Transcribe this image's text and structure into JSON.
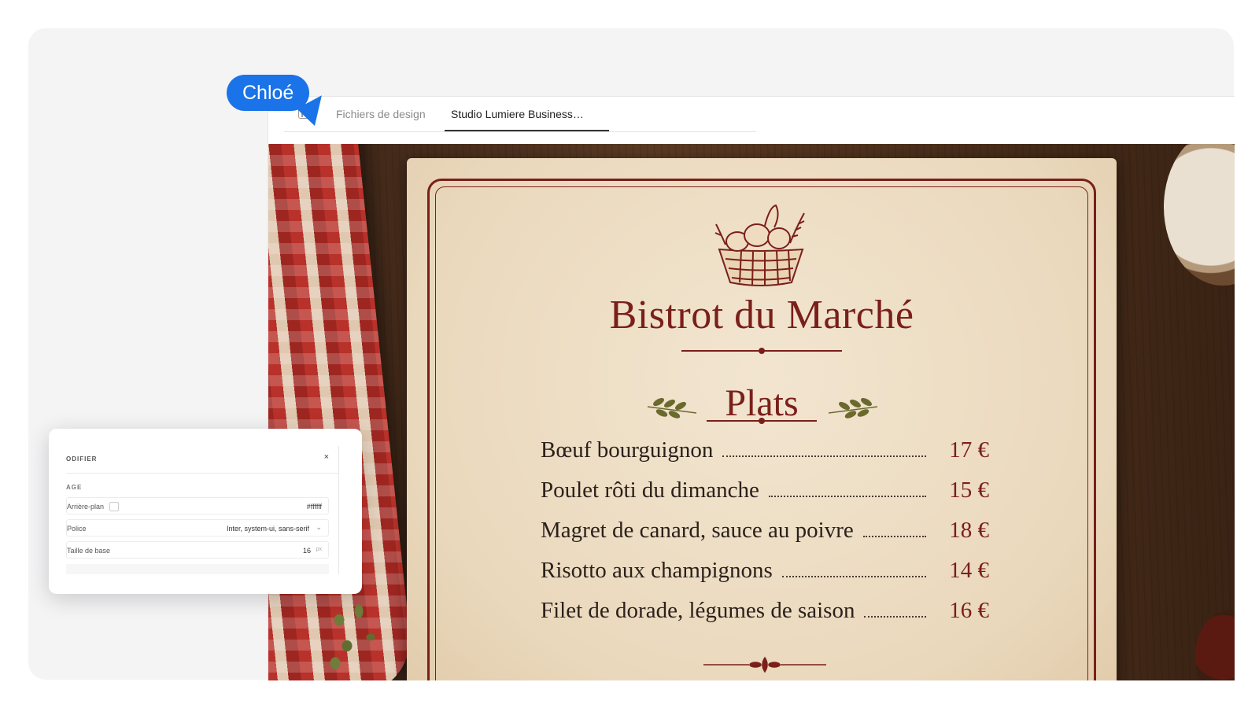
{
  "collaborator": {
    "name": "Chloé",
    "color": "#1a73e8"
  },
  "tabs": [
    {
      "label": "Fichiers de design"
    },
    {
      "label": "Studio Lumiere Business…"
    }
  ],
  "menu": {
    "restaurant_name": "Bistrot du Marché",
    "section_title": "Plats",
    "accent_color": "#7a1f1a",
    "dishes": [
      {
        "name": "Bœuf bourguignon",
        "price": "17 €"
      },
      {
        "name": "Poulet rôti du dimanche",
        "price": "15 €"
      },
      {
        "name": "Magret de canard, sauce au poivre",
        "price": "18 €"
      },
      {
        "name": "Risotto aux champignons",
        "price": "14 €"
      },
      {
        "name": "Filet de dorade, légumes de saison",
        "price": "16 €"
      }
    ]
  },
  "panel": {
    "title": "ODIFIER",
    "close": "×",
    "section": "AGE",
    "background_label": "Arrière-plan",
    "background_value": "#ffffff",
    "font_label": "Police",
    "font_value": "Inter, system-ui, sans-serif",
    "size_label": "Taille de base",
    "size_value": "16",
    "size_unit": "px"
  }
}
